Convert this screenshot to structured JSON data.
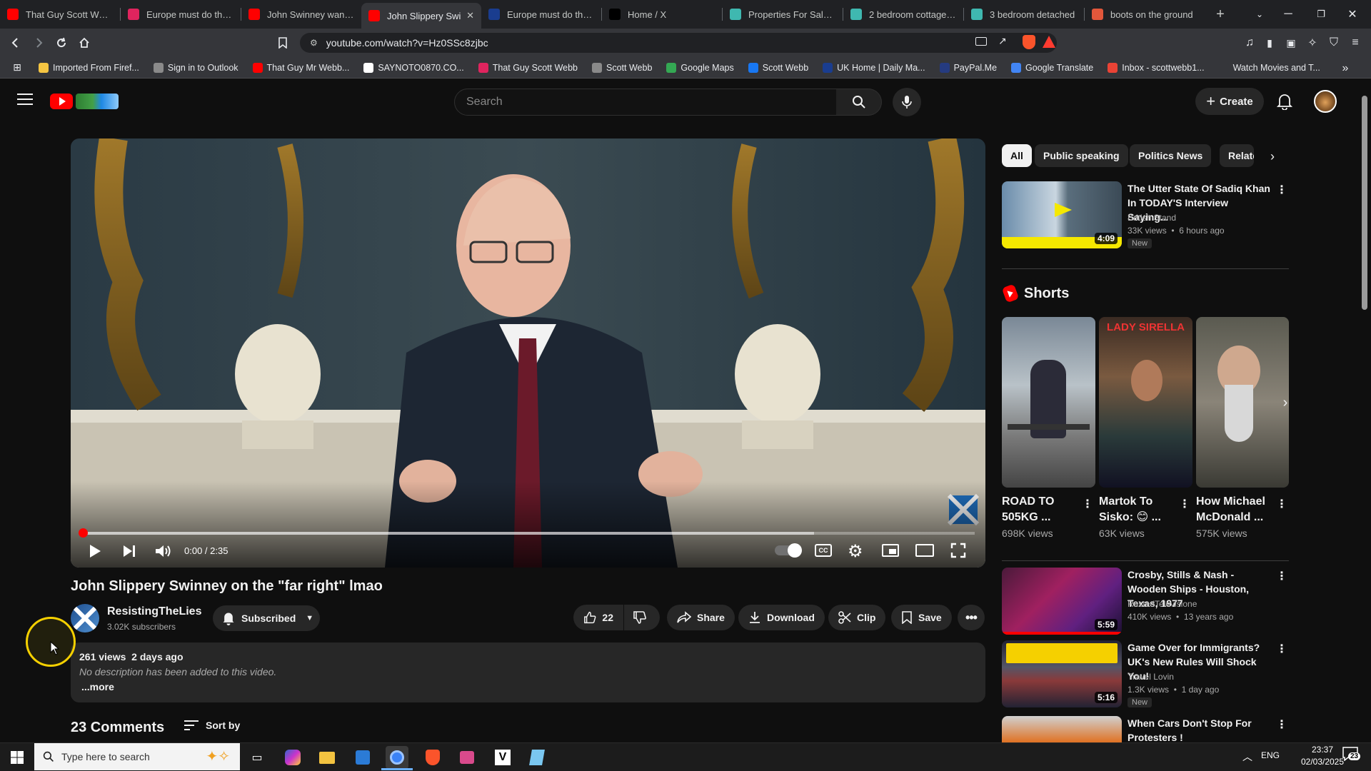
{
  "browser": {
    "tabs": [
      {
        "title": "That Guy Scott Webb",
        "icon_color": "#ff0000",
        "active": false
      },
      {
        "title": "Europe must do the 'h",
        "icon_color": "#e0245e",
        "active": false
      },
      {
        "title": "John Swinney wants t",
        "icon_color": "#ff0000",
        "active": false
      },
      {
        "title": "John Slippery Swi",
        "icon_color": "#ff0000",
        "active": true
      },
      {
        "title": "Europe must do the 'h",
        "icon_color": "#1a3d8f",
        "active": false
      },
      {
        "title": "Home / X",
        "icon_color": "#000000",
        "active": false
      },
      {
        "title": "Properties For Sale in",
        "icon_color": "#3fb8b0",
        "active": false
      },
      {
        "title": "2 bedroom cottage fo",
        "icon_color": "#3fb8b0",
        "active": false
      },
      {
        "title": "3 bedroom detached",
        "icon_color": "#3fb8b0",
        "active": false
      },
      {
        "title": "boots on the ground",
        "icon_color": "#e2573b",
        "active": false
      }
    ],
    "address": "youtube.com/watch?v=Hz0SSc8zjbc",
    "bookmarks": [
      {
        "label": "Imported From Firef...",
        "color": "#f5c542"
      },
      {
        "label": "Sign in to Outlook",
        "color": "#8a8a8a"
      },
      {
        "label": "That Guy Mr Webb...",
        "color": "#ff0000"
      },
      {
        "label": "SAYNOTO0870.CO...",
        "color": "#ffffff"
      },
      {
        "label": "That Guy Scott Webb",
        "color": "#e0245e"
      },
      {
        "label": "Scott Webb",
        "color": "#8a8a8a"
      },
      {
        "label": "Google Maps",
        "color": "#34a853"
      },
      {
        "label": "Scott Webb",
        "color": "#1877f2"
      },
      {
        "label": "UK Home | Daily Ma...",
        "color": "#1a3d8f"
      },
      {
        "label": "PayPal.Me",
        "color": "#253b80"
      },
      {
        "label": "Google Translate",
        "color": "#4285f4"
      },
      {
        "label": "Inbox - scottwebb1...",
        "color": "#ea4335"
      },
      {
        "label": "Watch Movies and T...",
        "color": "#35363a"
      }
    ]
  },
  "youtube": {
    "search_placeholder": "Search",
    "create_label": "Create",
    "video": {
      "title": "John Slippery Swinney on the \"far right\" lmao",
      "time": "0:00 / 2:35",
      "channel": "ResistingTheLies",
      "subscribers": "3.02K subscribers",
      "subscribed_label": "Subscribed",
      "likes": "22",
      "share_label": "Share",
      "download_label": "Download",
      "clip_label": "Clip",
      "save_label": "Save",
      "views_date": "261 views  2 days ago",
      "description": "No description has been added to this video.",
      "more_label": "...more",
      "comments_heading": "23 Comments",
      "sort_label": "Sort by"
    },
    "chips": [
      "All",
      "Public speaking",
      "Politics News",
      "Relate"
    ],
    "shorts_heading": "Shorts",
    "shorts": [
      {
        "title": "ROAD TO 505KG ...",
        "views": "698K views"
      },
      {
        "title": "Martok To Sisko: 😊 ...",
        "views": "63K views"
      },
      {
        "title": "How Michael McDonald ...",
        "views": "575K views"
      }
    ],
    "related": [
      {
        "title": "The Utter State Of Sadiq Khan In TODAY'S Interview Saying...",
        "channel": "British Stand",
        "meta": "33K views  •  6 hours ago",
        "badge": "New",
        "duration": "4:09"
      },
      {
        "title": "Crosby, Stills & Nash - Wooden Ships - Houston, Texas, 1977",
        "channel": "RustedTelevisione",
        "meta": "410K views  •  13 years ago",
        "badge": "",
        "duration": "5:59"
      },
      {
        "title": "Game Over for Immigrants? UK's New Rules Will Shock You!",
        "channel": "Travel Lovin",
        "meta": "1.3K views  •  1 day ago",
        "badge": "New",
        "duration": "5:16"
      },
      {
        "title": "When Cars Don't Stop For Protesters !",
        "channel": "",
        "meta": "",
        "badge": "",
        "duration": ""
      }
    ]
  },
  "taskbar": {
    "search_placeholder": "Type here to search",
    "language": "ENG",
    "time": "23:37",
    "date": "02/03/2025",
    "notification_count": "23"
  }
}
